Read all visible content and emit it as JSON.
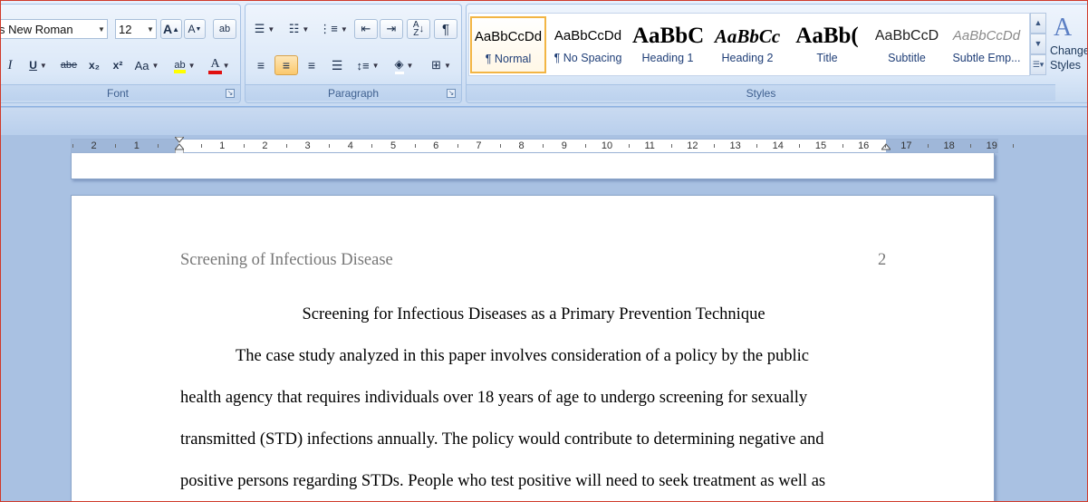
{
  "font_group": {
    "label": "Font",
    "font_name": "s New Roman",
    "font_size": "12",
    "grow_font_label": "A",
    "shrink_font_label": "A",
    "clear_format_label": "ab",
    "italic_label": "I",
    "underline_label": "U",
    "strikethrough_label": "abe",
    "subscript_label": "x₂",
    "superscript_label": "x²",
    "change_case_label": "Aa",
    "highlight_label": "ab",
    "font_color_label": "A",
    "highlight_color": "#ffff00",
    "font_color": "#e01010"
  },
  "paragraph_group": {
    "label": "Paragraph"
  },
  "styles_group": {
    "label": "Styles",
    "styles": [
      {
        "sample": "AaBbCcDd",
        "name": "¶ Normal",
        "selected": true
      },
      {
        "sample": "AaBbCcDd",
        "name": "¶ No Spacing",
        "selected": false
      },
      {
        "sample": "AaBbC(",
        "name": "Heading 1",
        "selected": false
      },
      {
        "sample": "AaBbCc",
        "name": "Heading 2",
        "selected": false
      },
      {
        "sample": "AaBb(",
        "name": "Title",
        "selected": false
      },
      {
        "sample": "AaBbCcD",
        "name": "Subtitle",
        "selected": false
      },
      {
        "sample": "AaBbCcDd",
        "name": "Subtle Emp...",
        "selected": false
      }
    ],
    "change_styles_line1": "Change",
    "change_styles_line2": "Styles"
  },
  "ruler": {
    "numbers": [
      "2",
      "1",
      "1",
      "2",
      "3",
      "4",
      "5",
      "6",
      "7",
      "8",
      "9",
      "10",
      "11",
      "12",
      "13",
      "14",
      "15",
      "16",
      "17",
      "18",
      "19"
    ]
  },
  "document": {
    "running_header": "Screening of Infectious Disease",
    "page_number": "2",
    "title": "Screening for Infectious Diseases as a Primary Prevention Technique",
    "lines": [
      "The case study analyzed in this paper involves consideration of a policy by the public",
      "health agency that requires individuals over 18 years of age to undergo screening for sexually",
      "transmitted (STD) infections annually. The policy would contribute to determining negative and",
      "positive persons regarding STDs.  People who test positive will need to seek treatment as well as"
    ]
  }
}
